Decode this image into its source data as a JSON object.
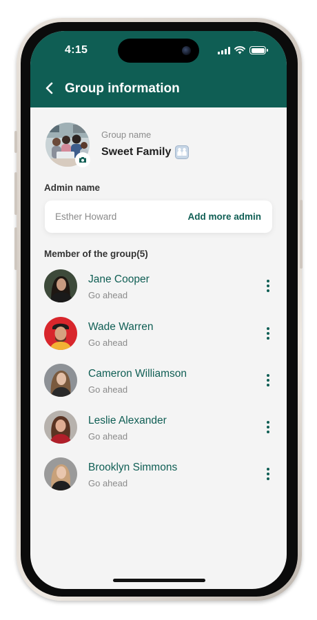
{
  "status_bar": {
    "time": "4:15"
  },
  "header": {
    "title": "Group information"
  },
  "group": {
    "name_label": "Group name",
    "name": "Sweet Family"
  },
  "admin": {
    "section_label": "Admin name",
    "name": "Esther Howard",
    "add_label": "Add more admin"
  },
  "members": {
    "section_label": "Member of the group(5)",
    "items": [
      {
        "name": "Jane Cooper",
        "status": "Go ahead"
      },
      {
        "name": "Wade Warren",
        "status": "Go ahead"
      },
      {
        "name": "Cameron Williamson",
        "status": "Go ahead"
      },
      {
        "name": "Leslie Alexander",
        "status": "Go ahead"
      },
      {
        "name": "Brooklyn Simmons",
        "status": "Go ahead"
      }
    ]
  },
  "colors": {
    "accent": "#0f5e54",
    "background": "#f4f4f4"
  }
}
